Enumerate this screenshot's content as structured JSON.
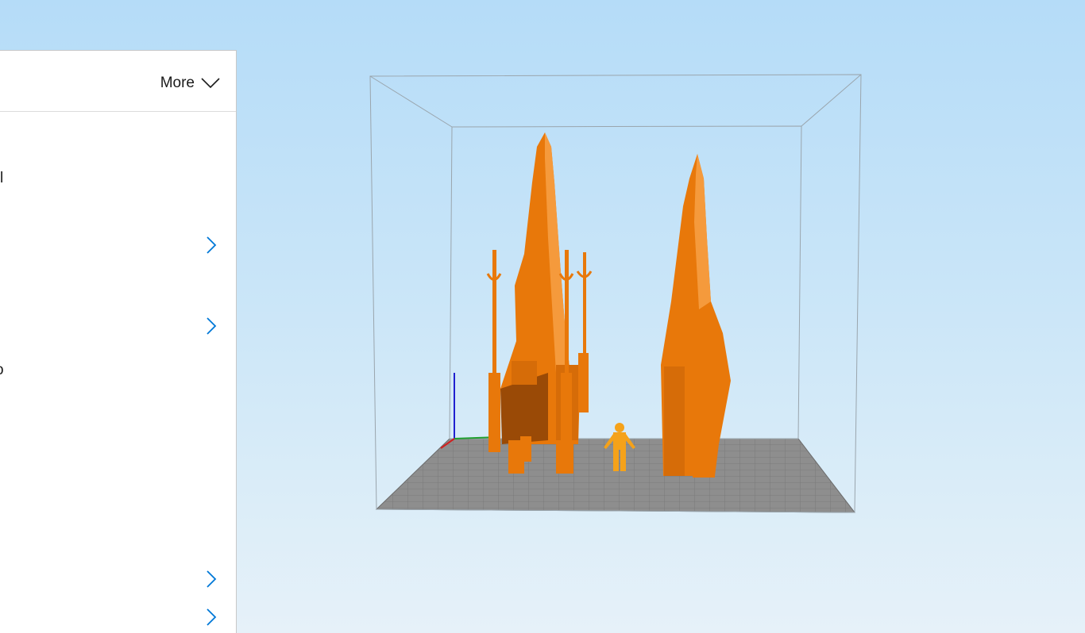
{
  "panel": {
    "more_label": "More",
    "clipped_text_1": "l",
    "clipped_text_2": "o"
  },
  "icons": {
    "more": "chevron-down-icon",
    "row": "chevron-right-icon"
  },
  "colors": {
    "accent": "#0078d7",
    "model": "#f07f0a",
    "figure": "#f5a21a",
    "plate": "#8c8c8c"
  }
}
